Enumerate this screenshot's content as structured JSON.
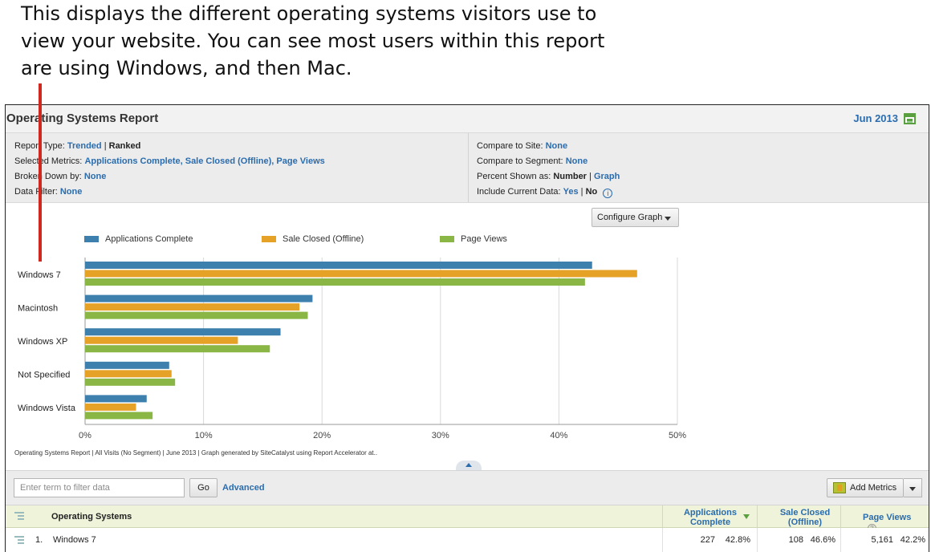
{
  "annotation": {
    "lines": [
      "This displays the different operating systems visitors use to",
      "view your website. You can see most users within this report",
      "are using Windows, and then Mac."
    ]
  },
  "report": {
    "title": "Operating Systems Report",
    "period": "Jun 2013",
    "calendar_icon": "calendar-icon"
  },
  "settings": {
    "report_type_label": "Report Type:",
    "report_type_trended": "Trended",
    "report_type_ranked": "Ranked",
    "selected_metrics_label": "Selected Metrics:",
    "selected_metrics_value": "Applications Complete, Sale Closed (Offline), Page Views",
    "broken_down_label": "Broken Down by:",
    "broken_down_value": "None",
    "data_filter_label": "Data Filter:",
    "data_filter_value": "None",
    "compare_site_label": "Compare to Site:",
    "compare_site_value": "None",
    "compare_segment_label": "Compare to Segment:",
    "compare_segment_value": "None",
    "percent_label": "Percent Shown as:",
    "percent_number": "Number",
    "percent_graph": "Graph",
    "include_current_label": "Include Current Data:",
    "include_yes": "Yes",
    "include_no": "No",
    "sep": "|",
    "info_icon_glyph": "i"
  },
  "graph": {
    "configure_label": "Configure Graph",
    "footnote": "Operating Systems Report | All Visits (No Segment) | June 2013 | Graph generated by SiteCatalyst using Report Accelerator at.."
  },
  "chart_data": {
    "type": "bar",
    "orientation": "horizontal",
    "categories": [
      "Windows 7",
      "Macintosh",
      "Windows XP",
      "Not Specified",
      "Windows Vista"
    ],
    "series": [
      {
        "name": "Applications Complete",
        "color": "#3d7fad",
        "values": [
          42.8,
          19.2,
          16.5,
          7.1,
          5.2
        ]
      },
      {
        "name": "Sale Closed (Offline)",
        "color": "#e6a127",
        "values": [
          46.6,
          18.1,
          12.9,
          7.3,
          4.3
        ]
      },
      {
        "name": "Page Views",
        "color": "#8ab646",
        "values": [
          42.2,
          18.8,
          15.6,
          7.6,
          5.7
        ]
      }
    ],
    "xlim": [
      0,
      50
    ],
    "xticks": [
      "0%",
      "10%",
      "20%",
      "30%",
      "40%",
      "50%"
    ],
    "grid": true,
    "legend_position": "top"
  },
  "filter": {
    "placeholder": "Enter term to filter data",
    "go_label": "Go",
    "advanced_label": "Advanced",
    "add_metrics_label": "Add Metrics"
  },
  "table": {
    "os_header": "Operating Systems",
    "metric_headers": [
      {
        "line1": "Applications",
        "line2": "Complete"
      },
      {
        "line1": "Sale Closed",
        "line2": "(Offline)"
      },
      {
        "line1": "Page Views",
        "line2": ""
      }
    ],
    "help_glyph": "?",
    "rows": [
      {
        "rank": "1.",
        "name": "Windows 7",
        "app_value": "227",
        "app_pct": "42.8%",
        "sale_value": "108",
        "sale_pct": "46.6%",
        "pv_value": "5,161",
        "pv_pct": "42.2%"
      }
    ]
  },
  "colors": {
    "link": "#2a6cae",
    "callout_line": "#d0281e"
  }
}
